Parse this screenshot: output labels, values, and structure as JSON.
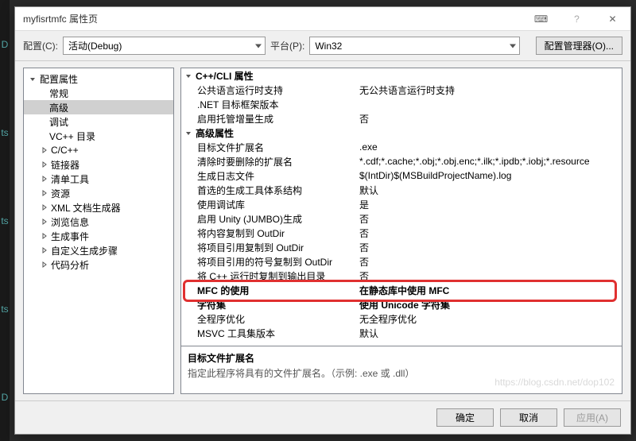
{
  "window": {
    "title": "myfisrtmfc 属性页",
    "help": "?",
    "close": "✕"
  },
  "topbar": {
    "config_label": "配置(C):",
    "config_value": "活动(Debug)",
    "platform_label": "平台(P):",
    "platform_value": "Win32",
    "manager": "配置管理器(O)..."
  },
  "tree": [
    {
      "label": "配置属性",
      "exp": "open",
      "d": 0
    },
    {
      "label": "常规",
      "d": 1
    },
    {
      "label": "高级",
      "d": 1,
      "sel": true
    },
    {
      "label": "调试",
      "d": 1
    },
    {
      "label": "VC++ 目录",
      "d": 1
    },
    {
      "label": "C/C++",
      "exp": "closed",
      "d": 0,
      "off": 14
    },
    {
      "label": "链接器",
      "exp": "closed",
      "d": 0,
      "off": 14
    },
    {
      "label": "清单工具",
      "exp": "closed",
      "d": 0,
      "off": 14
    },
    {
      "label": "资源",
      "exp": "closed",
      "d": 0,
      "off": 14
    },
    {
      "label": "XML 文档生成器",
      "exp": "closed",
      "d": 0,
      "off": 14
    },
    {
      "label": "浏览信息",
      "exp": "closed",
      "d": 0,
      "off": 14
    },
    {
      "label": "生成事件",
      "exp": "closed",
      "d": 0,
      "off": 14
    },
    {
      "label": "自定义生成步骤",
      "exp": "closed",
      "d": 0,
      "off": 14
    },
    {
      "label": "代码分析",
      "exp": "closed",
      "d": 0,
      "off": 14
    }
  ],
  "sections": [
    {
      "title": "C++/CLI 属性",
      "rows": [
        {
          "k": "公共语言运行时支持",
          "v": "无公共语言运行时支持"
        },
        {
          "k": ".NET 目标框架版本",
          "v": ""
        },
        {
          "k": "启用托管增量生成",
          "v": "否"
        }
      ]
    },
    {
      "title": "高级属性",
      "rows": [
        {
          "k": "目标文件扩展名",
          "v": ".exe"
        },
        {
          "k": "清除时要删除的扩展名",
          "v": "*.cdf;*.cache;*.obj;*.obj.enc;*.ilk;*.ipdb;*.iobj;*.resource"
        },
        {
          "k": "生成日志文件",
          "v": "$(IntDir)$(MSBuildProjectName).log"
        },
        {
          "k": "首选的生成工具体系结构",
          "v": "默认"
        },
        {
          "k": "使用调试库",
          "v": "是"
        },
        {
          "k": "启用 Unity (JUMBO)生成",
          "v": "否"
        },
        {
          "k": "将内容复制到 OutDir",
          "v": "否"
        },
        {
          "k": "将项目引用复制到 OutDir",
          "v": "否"
        },
        {
          "k": "将项目引用的符号复制到 OutDir",
          "v": "否"
        },
        {
          "k": "将 C++ 运行时复制到输出目录",
          "v": "否"
        },
        {
          "k": "MFC 的使用",
          "v": "在静态库中使用 MFC",
          "bold": true
        },
        {
          "k": "字符集",
          "v": "使用 Unicode 字符集",
          "bold": true
        },
        {
          "k": "全程序优化",
          "v": "无全程序优化"
        },
        {
          "k": "MSVC 工具集版本",
          "v": "默认"
        }
      ]
    }
  ],
  "desc": {
    "heading": "目标文件扩展名",
    "text": "指定此程序将具有的文件扩展名。（示例: .exe 或 .dll）"
  },
  "footer": {
    "ok": "确定",
    "cancel": "取消",
    "apply": "应用(A)"
  },
  "watermark": "https://blog.csdn.net/dop102"
}
